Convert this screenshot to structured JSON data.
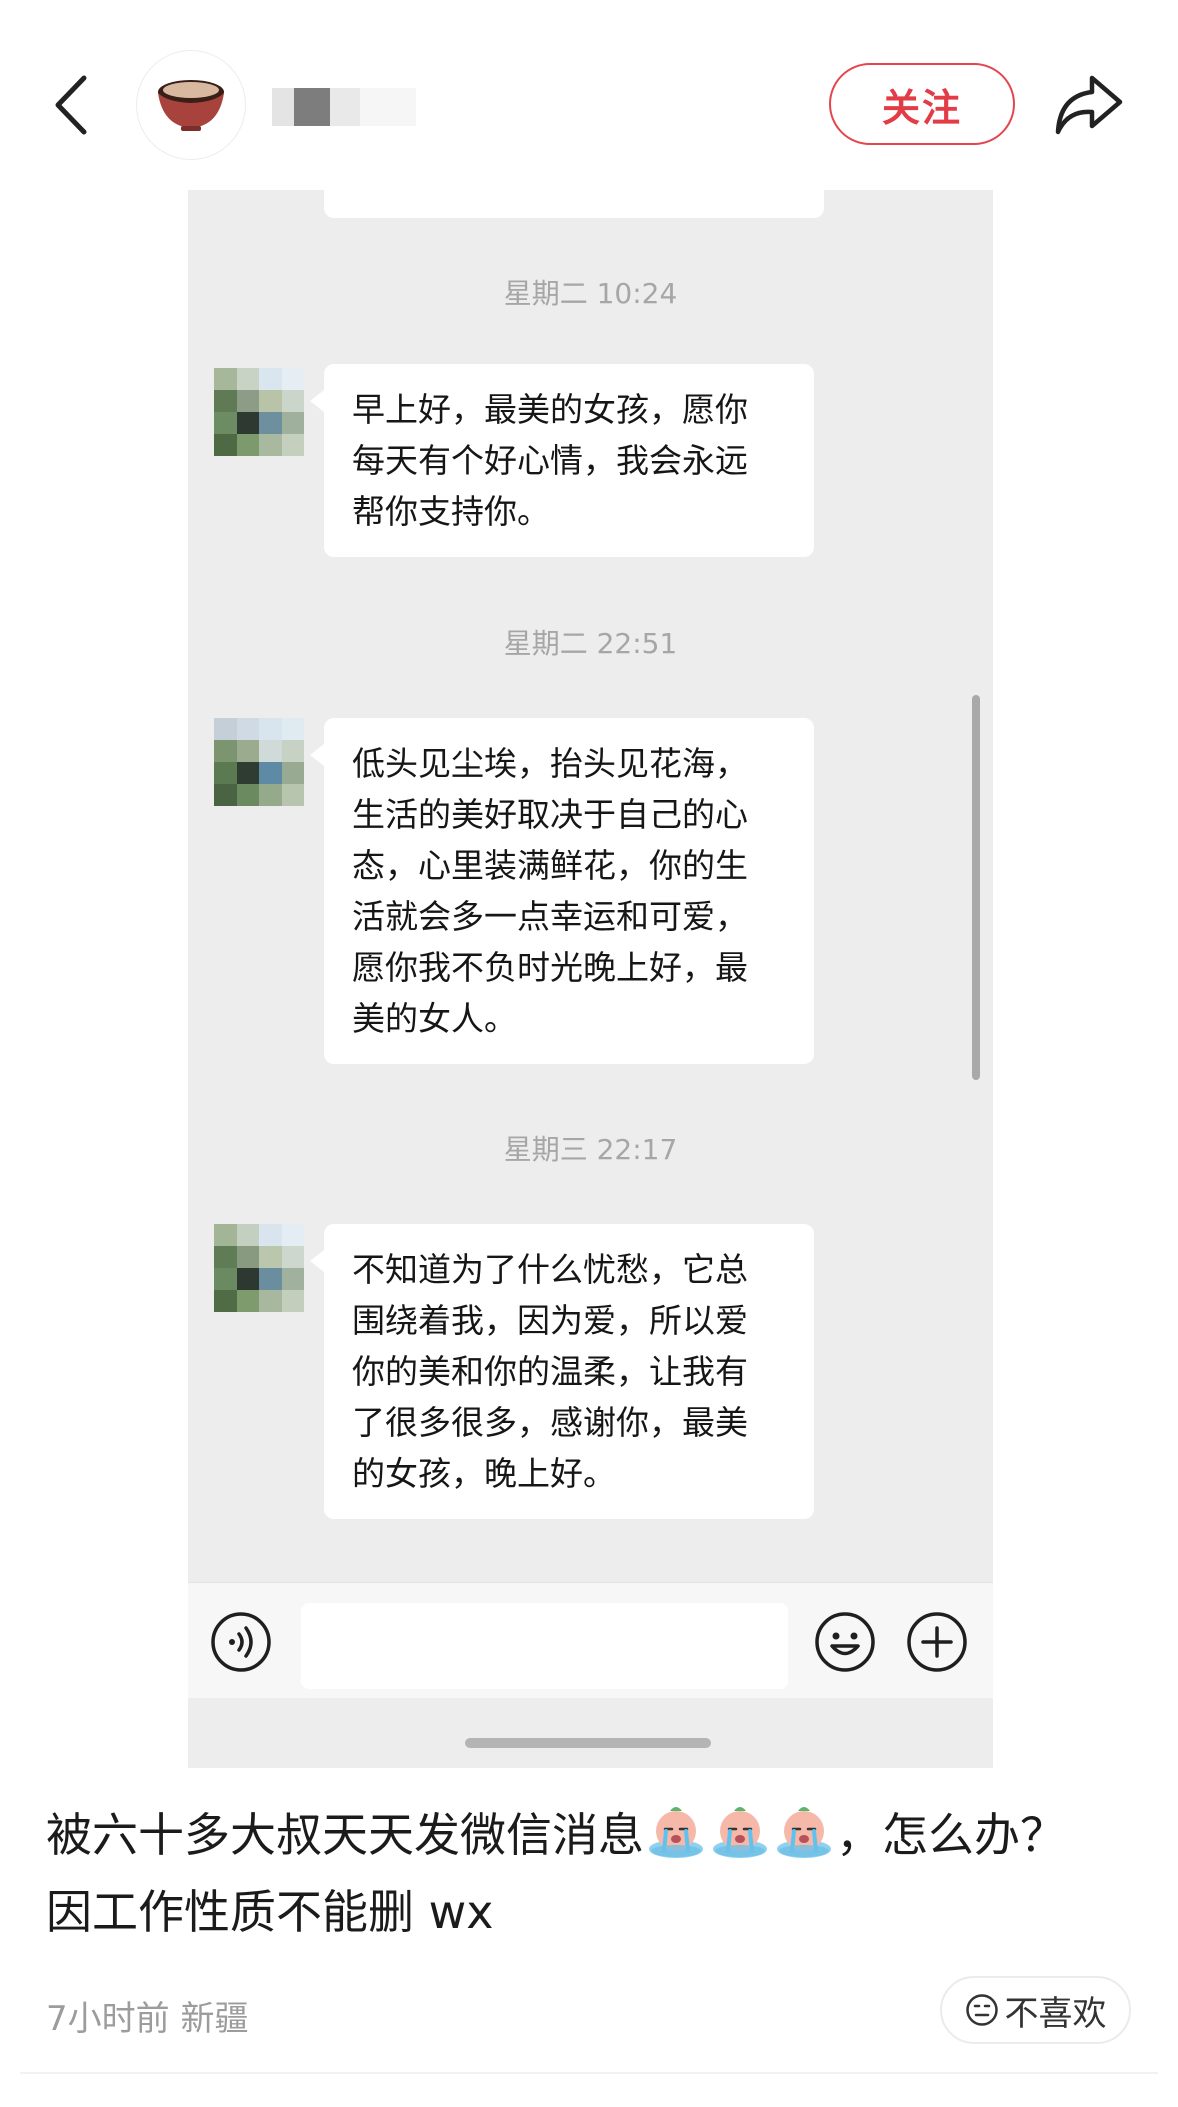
{
  "header": {
    "back_icon": "chevron-left-icon",
    "avatar_icon": "bowl-icon",
    "follow_label": "关注",
    "share_icon": "share-arrow-icon",
    "accent_color": "#e4464f"
  },
  "chat": {
    "messages": [
      {
        "timestamp": "星期二 10:24",
        "text": "早上好，最美的女孩，愿你\n每天有个好心情，我会永远\n帮你支持你。"
      },
      {
        "timestamp": "星期二 22:51",
        "text": "低头见尘埃，抬头见花海，\n生活的美好取决于自己的心\n态，心里装满鲜花，你的生\n活就会多一点幸运和可爱，\n愿你我不负时光晚上好，最\n美的女人。"
      },
      {
        "timestamp": "星期三 22:17",
        "text": "不知道为了什么忧愁，它总\n围绕着我，因为爱，所以爱\n你的美和你的温柔，让我有\n了很多很多，感谢你，最美\n的女孩，晚上好。"
      }
    ],
    "input_bar": {
      "voice_icon": "voice-icon",
      "emoji_icon": "smiley-icon",
      "plus_icon": "plus-circle-icon"
    }
  },
  "post": {
    "title_part1": "被六十多大叔天天发微信消息",
    "title_part2": "，怎么办？",
    "title_line2": "因工作性质不能删 wx",
    "emoji_icon": "crying-emoji-icon",
    "meta": "7小时前 新疆",
    "dislike_label": "不喜欢",
    "dislike_icon": "frown-face-icon"
  }
}
